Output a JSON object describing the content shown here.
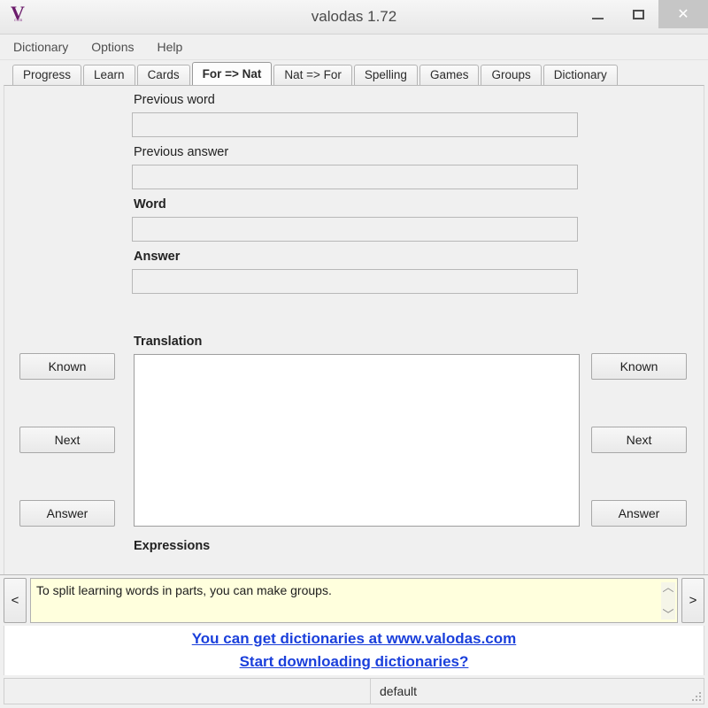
{
  "window": {
    "title": "valodas 1.72",
    "icon_name": "valodas-logo",
    "icon_letter": "V",
    "icon_subtext": "com",
    "controls": {
      "minimize": "minimize-icon",
      "maximize": "maximize-icon",
      "close": "✕"
    }
  },
  "menubar": {
    "items": [
      {
        "label": "Dictionary"
      },
      {
        "label": "Options"
      },
      {
        "label": "Help"
      }
    ]
  },
  "tabs": {
    "active": "For => Nat",
    "items": [
      {
        "label": "Progress",
        "active": false
      },
      {
        "label": "Learn",
        "active": false
      },
      {
        "label": "Cards",
        "active": false
      },
      {
        "label": "For => Nat",
        "active": true
      },
      {
        "label": "Nat => For",
        "active": false
      },
      {
        "label": "Spelling",
        "active": false
      },
      {
        "label": "Games",
        "active": false
      },
      {
        "label": "Groups",
        "active": false
      },
      {
        "label": "Dictionary",
        "active": false
      }
    ]
  },
  "form": {
    "fields": [
      {
        "label": "Previous word",
        "value": "",
        "placeholder": "",
        "bold": false
      },
      {
        "label": "Previous answer",
        "value": "",
        "placeholder": "",
        "bold": false
      },
      {
        "label": "Word",
        "value": "",
        "placeholder": "",
        "bold": true
      },
      {
        "label": "Answer",
        "value": "",
        "placeholder": "",
        "bold": true
      }
    ],
    "translation_label": "Translation",
    "translation_value": "",
    "expressions_label": "Expressions"
  },
  "left_buttons": [
    {
      "label": "Known"
    },
    {
      "label": "Next"
    },
    {
      "label": "Answer"
    }
  ],
  "right_buttons": [
    {
      "label": "Known"
    },
    {
      "label": "Next"
    },
    {
      "label": "Answer"
    }
  ],
  "tipbar": {
    "prev_label": "<",
    "next_label": ">",
    "text": "To split learning words in parts, you can make groups.",
    "scroll_up": "︿",
    "scroll_down": "﹀",
    "background_color": "#ffffdd"
  },
  "links": [
    {
      "label": "You can get dictionaries at www.valodas.com"
    },
    {
      "label": "Start downloading dictionaries?"
    }
  ],
  "statusbar": {
    "panel_1": "",
    "panel_2": "default"
  },
  "colors": {
    "window_background": "#f0f0f0",
    "link_color": "#1a3fdb",
    "tip_background": "#ffffdd",
    "logo_purple": "#6b1b6b",
    "close_button": "#c6c6c6"
  }
}
